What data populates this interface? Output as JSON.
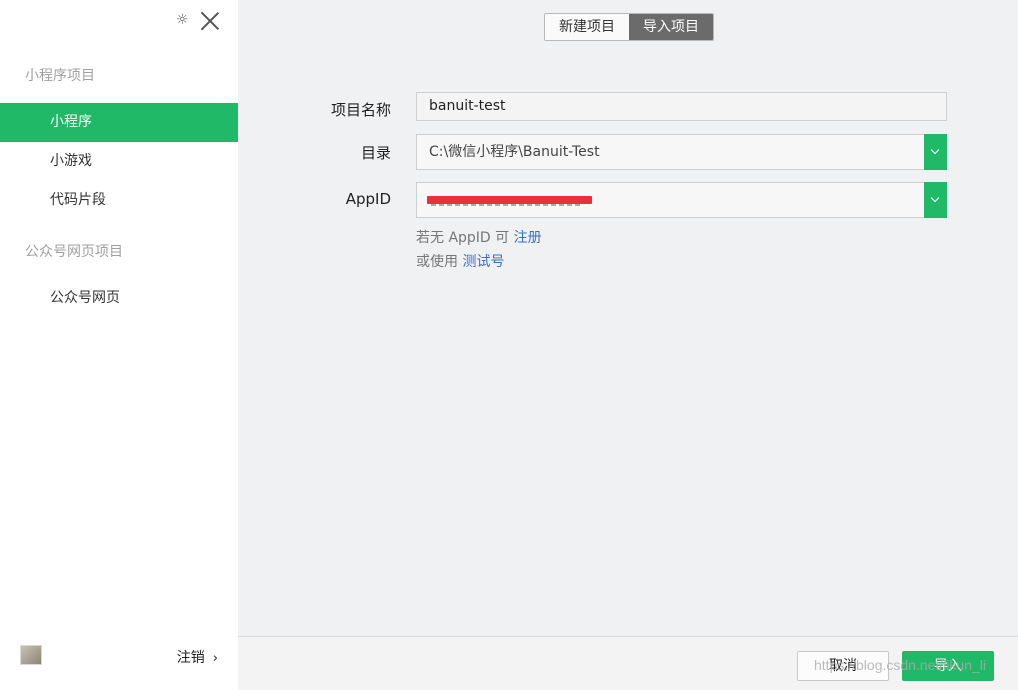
{
  "sidebar": {
    "sections": [
      {
        "title": "小程序项目"
      },
      {
        "title": "公众号网页项目"
      }
    ],
    "items": [
      {
        "label": "小程序"
      },
      {
        "label": "小游戏"
      },
      {
        "label": "代码片段"
      },
      {
        "label": "公众号网页"
      }
    ],
    "footer": {
      "logout_label": "注销",
      "arrow": "›"
    }
  },
  "tabs": [
    {
      "label": "新建项目"
    },
    {
      "label": "导入项目"
    }
  ],
  "form": {
    "name_label": "项目名称",
    "name_value": "banuit-test",
    "dir_label": "目录",
    "dir_value": "C:\\微信小程序\\Banuit-Test",
    "appid_label": "AppID"
  },
  "hints": {
    "line1_text": "若无 AppID 可",
    "line1_link": "注册",
    "line2_text": "或使用",
    "line2_link": "测试号"
  },
  "buttons": {
    "cancel": "取消",
    "import": "导入"
  },
  "watermark": "https://blog.csdn.net/likun_li",
  "colors": {
    "accent": "#1fb968",
    "link": "#3b6fc9",
    "redaction": "#e8313a",
    "active_tab": "#6b6b6b"
  },
  "icons": [
    "gear-icon",
    "close-icon",
    "chevron-down-icon",
    "chevron-right-icon",
    "avatar"
  ]
}
